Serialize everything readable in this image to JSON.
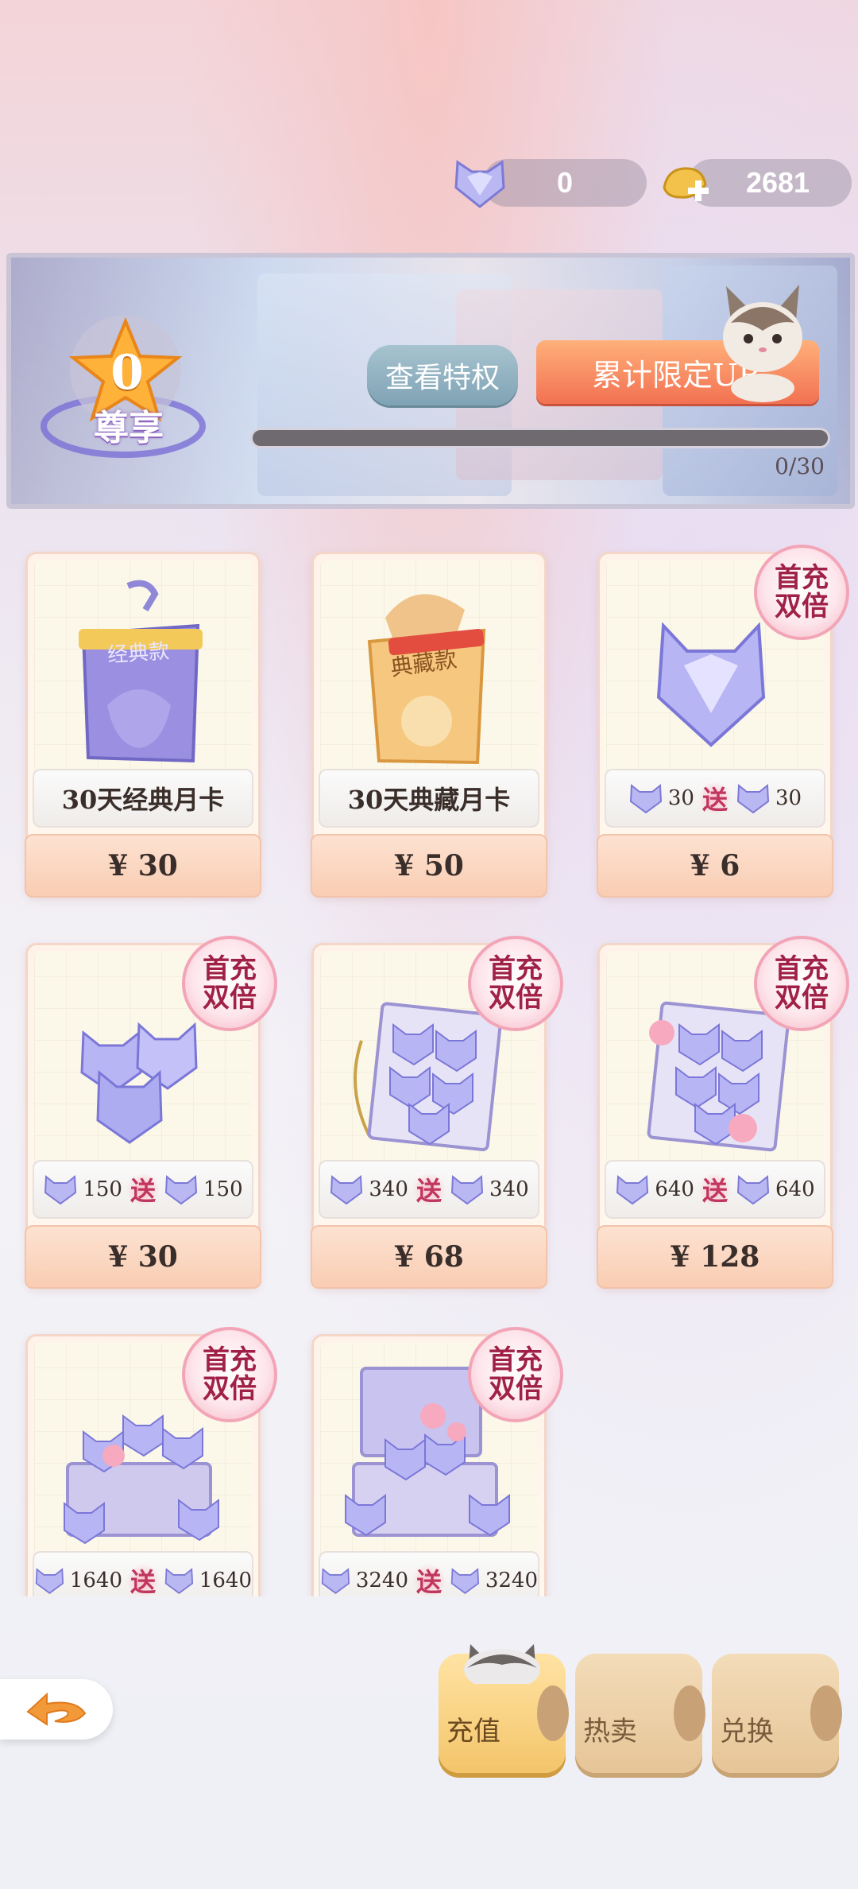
{
  "currency": {
    "gems": "0",
    "coins": "2681"
  },
  "vip": {
    "level": "0",
    "title": "尊享",
    "privilege_button": "查看特权",
    "ur_button": "累计限定UR",
    "progress_text": "0/30",
    "progress_fraction": 0
  },
  "badge": {
    "line1": "首充",
    "line2": "双倍"
  },
  "bonus_word": "送",
  "products": [
    {
      "name": "30天经典月卡",
      "price": "¥ 30",
      "pack_text": "经典款"
    },
    {
      "name": "30天典藏月卡",
      "price": "¥ 50",
      "pack_text": "典藏款"
    },
    {
      "base": "30",
      "bonus": "30",
      "price": "¥ 6"
    },
    {
      "base": "150",
      "bonus": "150",
      "price": "¥ 30"
    },
    {
      "base": "340",
      "bonus": "340",
      "price": "¥ 68"
    },
    {
      "base": "640",
      "bonus": "640",
      "price": "¥ 128"
    },
    {
      "base": "1640",
      "bonus": "1640"
    },
    {
      "base": "3240",
      "bonus": "3240"
    }
  ],
  "tabs": [
    {
      "label": "充值"
    },
    {
      "label": "热卖"
    },
    {
      "label": "兑换"
    }
  ]
}
